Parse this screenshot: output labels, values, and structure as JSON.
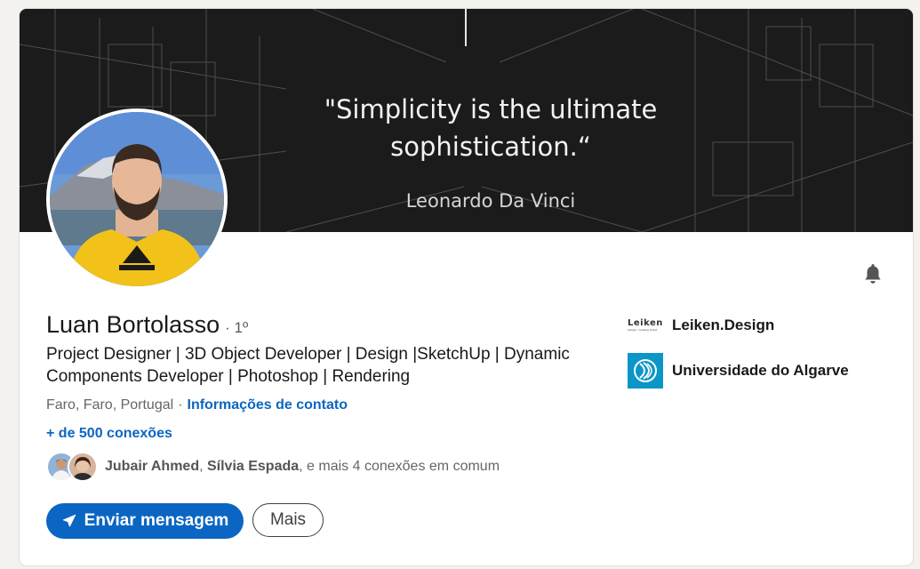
{
  "banner": {
    "quote_line1": "\"Simplicity is the ultimate",
    "quote_line2": "sophistication.“",
    "author": "Leonardo Da Vinci"
  },
  "profile": {
    "name": "Luan Bortolasso",
    "degree": "· 1º",
    "headline_line1": "Project Designer | 3D Object Developer | Design |SketchUp | Dynamic",
    "headline_line2": "Components Developer | Photoshop | Rendering",
    "location": "Faro, Faro, Portugal",
    "location_sep": "·",
    "contact_info_link": "Informações de contato",
    "connections": "+ de 500 conexões"
  },
  "mutual": {
    "name1": "Jubair Ahmed",
    "comma": ", ",
    "name2": "Sílvia Espada",
    "rest": ", e mais 4 conexões em comum"
  },
  "actions": {
    "message_label": "Enviar mensagem",
    "more_label": "Mais"
  },
  "organizations": [
    {
      "logo_text": "Leiken",
      "logo_tagline": "design · creating brand",
      "name": "Leiken.Design"
    },
    {
      "name": "Universidade do Algarve"
    }
  ],
  "colors": {
    "accent": "#0a66c2",
    "page_bg": "#f3f2ef",
    "ualg_blue": "#0b96c8"
  },
  "icons": {
    "bell": "bell-icon",
    "send": "send-icon"
  }
}
